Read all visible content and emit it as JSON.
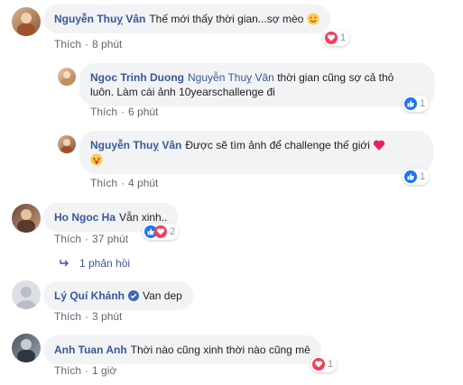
{
  "colors": {
    "name": "#385898",
    "bubble": "#f2f3f5",
    "meta": "#606770",
    "like_blue": "#1877f2",
    "love_red": "#f33e58"
  },
  "comments": [
    {
      "author": "Nguyễn Thuỵ Vân",
      "text": "Thế mới thấy thời gian...sợ mèo",
      "emoji": "heart-eyes-emoji",
      "like_label": "Thích",
      "time": "8 phút",
      "reactions": [
        "love"
      ],
      "reaction_count": "1"
    },
    {
      "author": "Ngoc Trinh Duong",
      "tag": "Nguyễn Thuỵ Vân",
      "text_line1": "thời gian cũng sợ cả thỏ",
      "text_line2": "luôn. Làm cái ảnh 10yearschallenge đi",
      "like_label": "Thích",
      "time": "6 phút",
      "reactions": [
        "like"
      ],
      "reaction_count": "1"
    },
    {
      "author": "Nguyễn Thuỵ Vân",
      "text": "Được sẽ tìm ảnh để challenge thế giới",
      "emoji": "heart-emoji",
      "emoji2": "tongue-emoji",
      "like_label": "Thích",
      "time": "4 phút",
      "reactions": [
        "like"
      ],
      "reaction_count": "1"
    },
    {
      "author": "Ho Ngoc Ha",
      "text": "Vẫn xinh..",
      "like_label": "Thích",
      "time": "37 phút",
      "reactions": [
        "like",
        "love"
      ],
      "reaction_count": "2",
      "replies_label": "1 phản hồi"
    },
    {
      "author": "Lý Quí Khánh",
      "verified": true,
      "text": "Van dep",
      "like_label": "Thích",
      "time": "3 phút"
    },
    {
      "author": "Anh Tuan Anh",
      "text": "Thời nào cũng xinh thời nào cũng mê",
      "like_label": "Thích",
      "time": "1 giờ",
      "reactions": [
        "love"
      ],
      "reaction_count": "1"
    }
  ]
}
